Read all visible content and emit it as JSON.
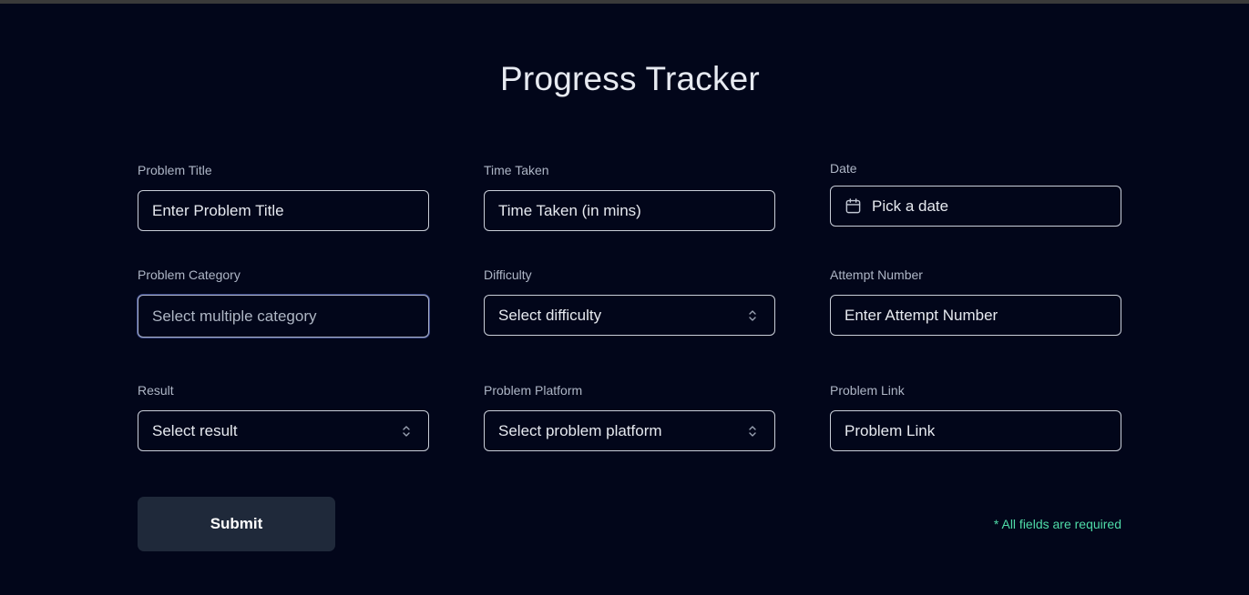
{
  "page": {
    "title": "Progress Tracker"
  },
  "fields": {
    "problem_title": {
      "label": "Problem Title",
      "placeholder": "Enter Problem Title"
    },
    "time_taken": {
      "label": "Time Taken",
      "placeholder": "Time Taken (in mins)"
    },
    "date": {
      "label": "Date",
      "placeholder": "Pick a date",
      "icon": "calendar-icon"
    },
    "problem_category": {
      "label": "Problem Category",
      "placeholder": "Select multiple category"
    },
    "difficulty": {
      "label": "Difficulty",
      "placeholder": "Select difficulty",
      "icon": "chevron-updown-icon"
    },
    "attempt_number": {
      "label": "Attempt Number",
      "placeholder": "Enter Attempt Number"
    },
    "result": {
      "label": "Result",
      "placeholder": "Select result",
      "icon": "chevron-updown-icon"
    },
    "problem_platform": {
      "label": "Problem Platform",
      "placeholder": "Select problem platform",
      "icon": "chevron-updown-icon"
    },
    "problem_link": {
      "label": "Problem Link",
      "placeholder": "Problem Link"
    }
  },
  "actions": {
    "submit_label": "Submit"
  },
  "footer": {
    "required_note": "* All fields are required"
  },
  "colors": {
    "background": "#02061a",
    "button_bg": "#1f293a",
    "accent_note": "#4fdca8",
    "border": "#c9ced8"
  }
}
